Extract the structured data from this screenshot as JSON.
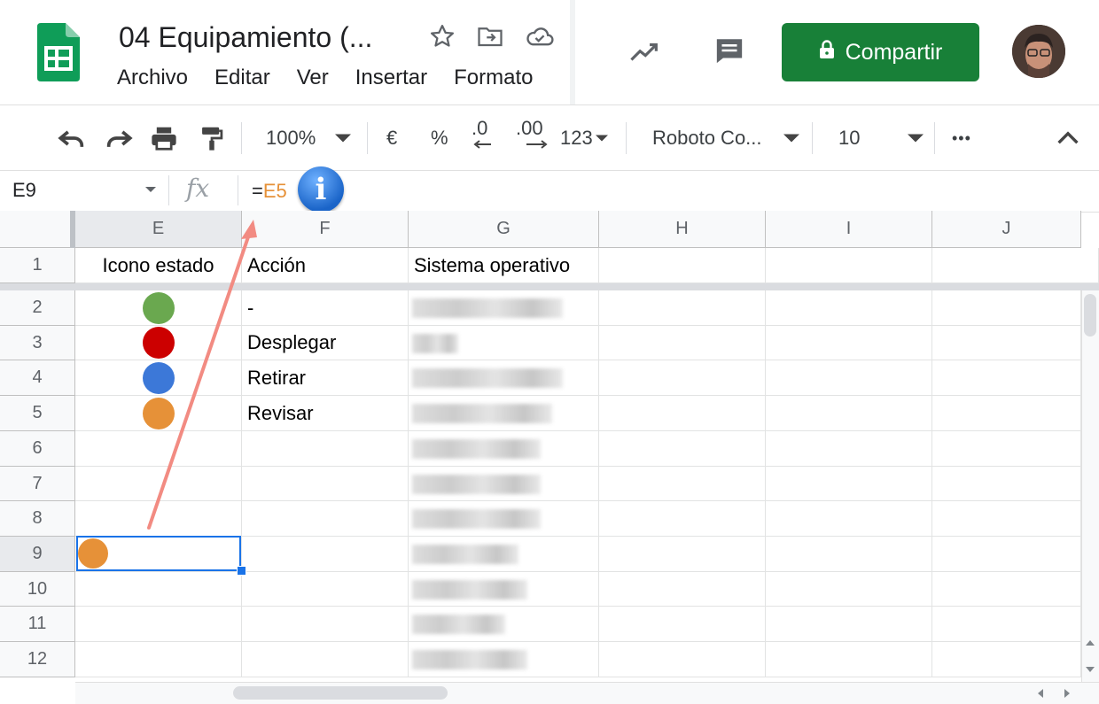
{
  "header": {
    "title": "04 Equipamiento (...",
    "menu": [
      "Archivo",
      "Editar",
      "Ver",
      "Insertar",
      "Formato"
    ],
    "share_label": "Compartir"
  },
  "toolbar": {
    "zoom": "100%",
    "currency": "€",
    "percent": "%",
    "dec_less": ".0",
    "dec_more": ".00",
    "format_more": "123",
    "font": "Roboto Co...",
    "font_size": "10",
    "more": "•••"
  },
  "formula_bar": {
    "name_box": "E9",
    "fx": "fx",
    "formula_prefix": "=",
    "formula_ref": "E5",
    "info": "i"
  },
  "grid": {
    "columns": [
      "E",
      "F",
      "G",
      "H",
      "I",
      "J"
    ],
    "rows": [
      "1",
      "2",
      "3",
      "4",
      "5",
      "6",
      "7",
      "8",
      "9",
      "10",
      "11",
      "12"
    ],
    "header_row": {
      "E": "Icono estado",
      "F": "Acción",
      "G": "Sistema operativo"
    },
    "actions": [
      "-",
      "Desplegar",
      "Retirar",
      "Revisar"
    ],
    "status_colors": [
      "#6aa84f",
      "#cc0000",
      "#3c78d8",
      "#e69138"
    ],
    "selected_cell_color": "#e69138",
    "selected_cell": "E9"
  }
}
